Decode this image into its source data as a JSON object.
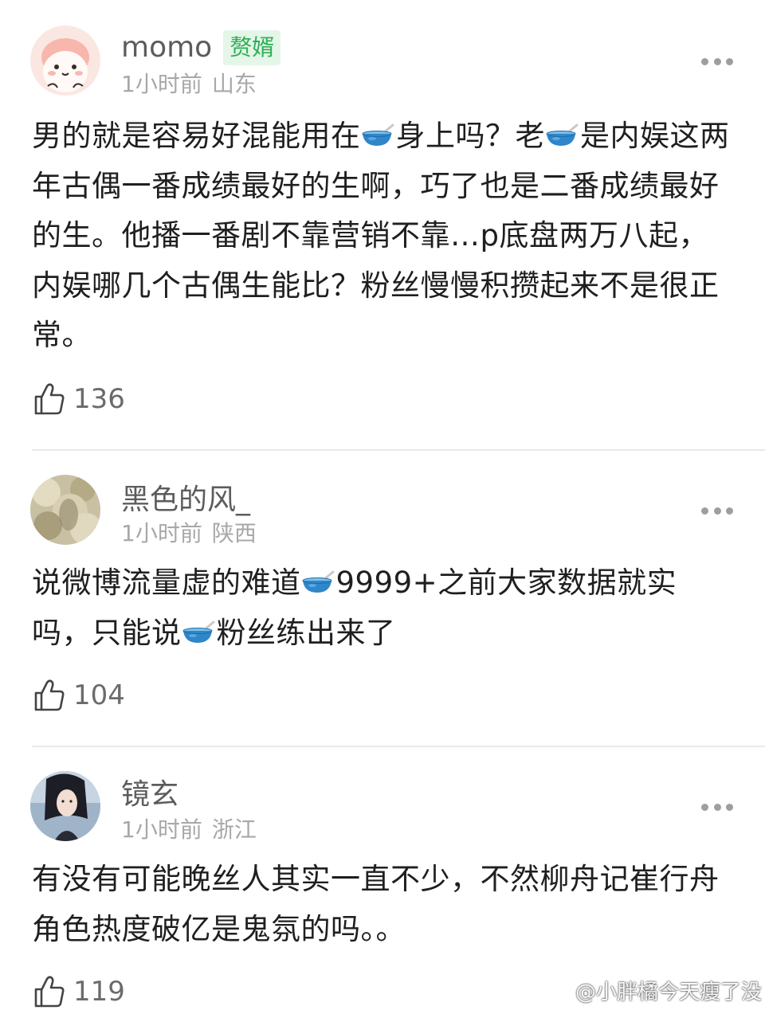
{
  "comments": [
    {
      "username": "momo",
      "badge": "赘婿",
      "time": "1小时前",
      "location": "山东",
      "text_parts": [
        "男的就是容易好混能用在",
        "身上吗？老",
        "是内娱这两年古偶一番成绩最好的生啊，巧了也是二番成绩最好的生。他播一番剧不靠营销不靠…p底盘两万八起，内娱哪几个古偶生能比？粉丝慢慢积攒起来不是很正常。"
      ],
      "likes": "136"
    },
    {
      "username": "黑色的风_",
      "time": "1小时前",
      "location": "陕西",
      "text_parts": [
        "说微博流量虚的难道",
        "9999+之前大家数据就实吗，只能说",
        "粉丝练出来了"
      ],
      "likes": "104"
    },
    {
      "username": "镜玄",
      "time": "1小时前",
      "location": "浙江",
      "text": "有没有可能晚丝人其实一直不少，不然柳舟记崔行舟角色热度破亿是鬼氛的吗。。",
      "likes": "119"
    }
  ],
  "icons": {
    "inline_emoji": "bowl-emoji-icon",
    "like": "thumbs-up-icon",
    "more": "more-dots-icon"
  },
  "watermark": "@小胖橘今天瘦了没",
  "colors": {
    "badge_bg": "#e4f6e8",
    "badge_text": "#2fae55",
    "meta": "#a8a8a8",
    "bowl": "#2f86c9"
  }
}
